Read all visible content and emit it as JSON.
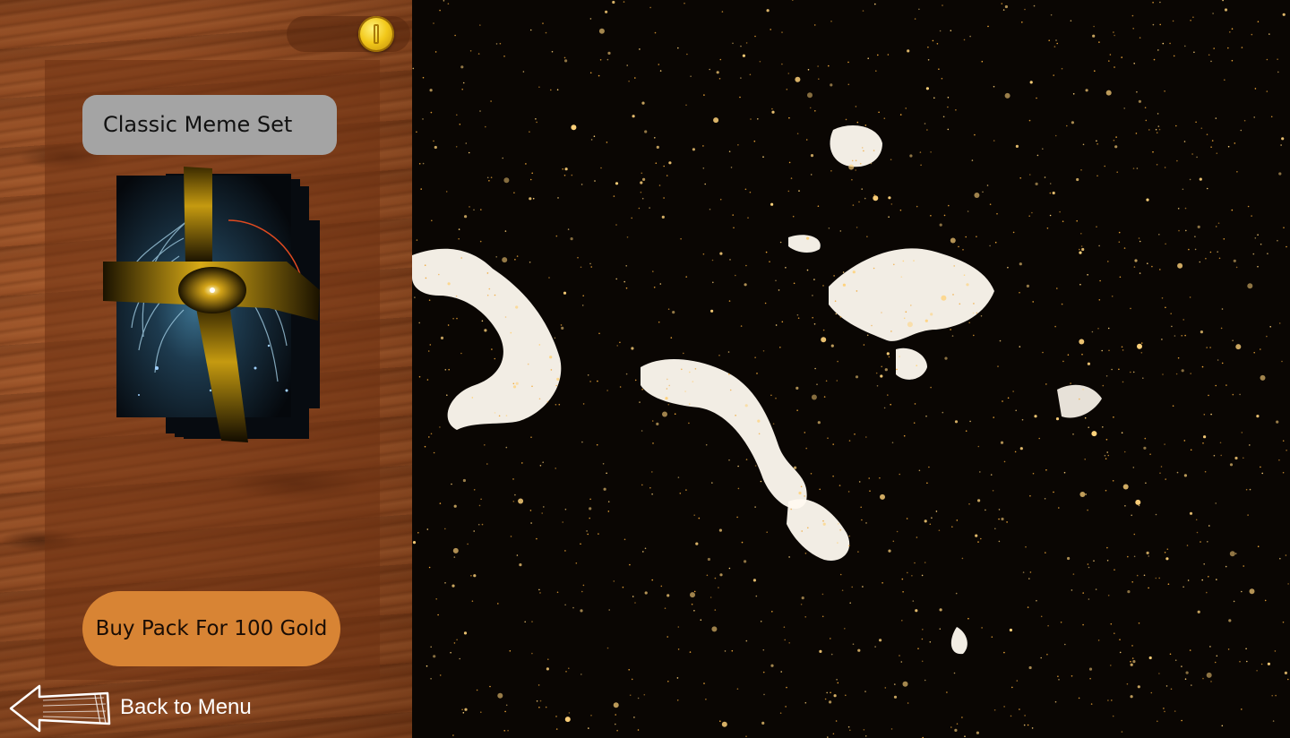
{
  "currency": {
    "icon": "gold-coin-icon",
    "amount": ""
  },
  "pack": {
    "title": "Classic Meme Set",
    "art_icon": "card-pack-art",
    "buy_label": "Buy Pack For 100 Gold"
  },
  "navigation": {
    "back_label": "Back to Menu",
    "back_icon": "back-arrow-icon"
  },
  "colors": {
    "wood": "#8c4720",
    "card_panel": "#6e3212",
    "title_bg": "#a4a4a4",
    "buy_button": "#d88434",
    "space": "#0a0603",
    "stars": "#ffd27a"
  }
}
